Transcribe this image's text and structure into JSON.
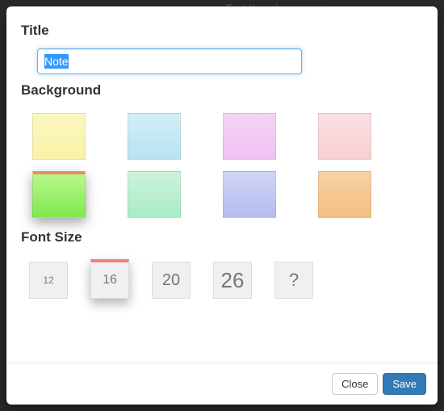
{
  "obscured_text": "Test this chrome app",
  "sections": {
    "title_label": "Title",
    "background_label": "Background",
    "fontsize_label": "Font Size"
  },
  "title": {
    "value": "Note",
    "placeholder": ""
  },
  "backgrounds": [
    {
      "name": "yellow",
      "selected": false
    },
    {
      "name": "blue",
      "selected": false
    },
    {
      "name": "pink",
      "selected": false
    },
    {
      "name": "rose",
      "selected": false
    },
    {
      "name": "green",
      "selected": true
    },
    {
      "name": "mint",
      "selected": false
    },
    {
      "name": "purple",
      "selected": false
    },
    {
      "name": "orange",
      "selected": false
    }
  ],
  "font_sizes": [
    {
      "label": "12",
      "selected": false
    },
    {
      "label": "16",
      "selected": true
    },
    {
      "label": "20",
      "selected": false
    },
    {
      "label": "26",
      "selected": false
    },
    {
      "label": "?",
      "selected": false
    }
  ],
  "buttons": {
    "close": "Close",
    "save": "Save"
  }
}
